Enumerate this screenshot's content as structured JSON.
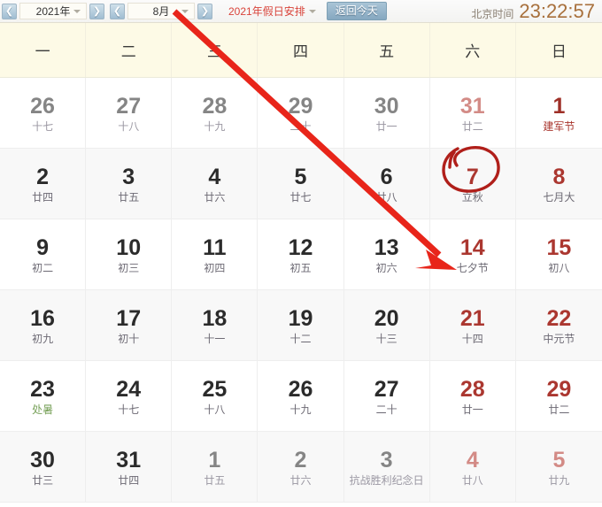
{
  "toolbar": {
    "prev_year_icon": "chevron-left-icon",
    "next_year_icon": "chevron-right-icon",
    "prev_month_icon": "chevron-left-icon",
    "next_month_icon": "chevron-right-icon",
    "year_value": "2021年",
    "month_value": "8月",
    "holiday_label": "2021年假日安排",
    "today_label": "返回今天",
    "clock_label": "北京时间",
    "clock_time": "23:22:57"
  },
  "weekdays": [
    "一",
    "二",
    "三",
    "四",
    "五",
    "六",
    "日"
  ],
  "colors": {
    "header_bg": "#fdfae6",
    "weekend_red": "#ab3730",
    "festival_red": "#a8342c",
    "solar_term_green": "#7aa35c",
    "other_month_gray": "#858585",
    "accent_blue": "#86a8c0",
    "clock_brown": "#a8703c",
    "annotation_red": "#e8251a"
  },
  "days": [
    {
      "num": "26",
      "sub": "十七",
      "type": "other"
    },
    {
      "num": "27",
      "sub": "十八",
      "type": "other"
    },
    {
      "num": "28",
      "sub": "十九",
      "type": "other"
    },
    {
      "num": "29",
      "sub": "二十",
      "type": "other"
    },
    {
      "num": "30",
      "sub": "廿一",
      "type": "other"
    },
    {
      "num": "31",
      "sub": "廿二",
      "type": "other-weekend"
    },
    {
      "num": "1",
      "sub": "建军节",
      "type": "festival",
      "sub_style": "fest"
    },
    {
      "num": "2",
      "sub": "廿四",
      "type": "normal"
    },
    {
      "num": "3",
      "sub": "廿五",
      "type": "normal"
    },
    {
      "num": "4",
      "sub": "廿六",
      "type": "normal"
    },
    {
      "num": "5",
      "sub": "廿七",
      "type": "normal"
    },
    {
      "num": "6",
      "sub": "廿八",
      "type": "normal"
    },
    {
      "num": "7",
      "sub": "立秋",
      "type": "weekend",
      "sub_style": "term",
      "circled": true
    },
    {
      "num": "8",
      "sub": "七月大",
      "type": "weekend"
    },
    {
      "num": "9",
      "sub": "初二",
      "type": "normal"
    },
    {
      "num": "10",
      "sub": "初三",
      "type": "normal"
    },
    {
      "num": "11",
      "sub": "初四",
      "type": "normal"
    },
    {
      "num": "12",
      "sub": "初五",
      "type": "normal"
    },
    {
      "num": "13",
      "sub": "初六",
      "type": "normal"
    },
    {
      "num": "14",
      "sub": "七夕节",
      "type": "weekend",
      "sub_style": "fest"
    },
    {
      "num": "15",
      "sub": "初八",
      "type": "weekend"
    },
    {
      "num": "16",
      "sub": "初九",
      "type": "normal"
    },
    {
      "num": "17",
      "sub": "初十",
      "type": "normal"
    },
    {
      "num": "18",
      "sub": "十一",
      "type": "normal"
    },
    {
      "num": "19",
      "sub": "十二",
      "type": "normal"
    },
    {
      "num": "20",
      "sub": "十三",
      "type": "normal"
    },
    {
      "num": "21",
      "sub": "十四",
      "type": "weekend"
    },
    {
      "num": "22",
      "sub": "中元节",
      "type": "weekend",
      "sub_style": "fest"
    },
    {
      "num": "23",
      "sub": "处暑",
      "type": "normal",
      "sub_style": "term"
    },
    {
      "num": "24",
      "sub": "十七",
      "type": "normal"
    },
    {
      "num": "25",
      "sub": "十八",
      "type": "normal"
    },
    {
      "num": "26",
      "sub": "十九",
      "type": "normal"
    },
    {
      "num": "27",
      "sub": "二十",
      "type": "normal"
    },
    {
      "num": "28",
      "sub": "廿一",
      "type": "weekend"
    },
    {
      "num": "29",
      "sub": "廿二",
      "type": "weekend"
    },
    {
      "num": "30",
      "sub": "廿三",
      "type": "normal"
    },
    {
      "num": "31",
      "sub": "廿四",
      "type": "normal"
    },
    {
      "num": "1",
      "sub": "廿五",
      "type": "other"
    },
    {
      "num": "2",
      "sub": "廿六",
      "type": "other"
    },
    {
      "num": "3",
      "sub": "抗战胜利纪念日",
      "type": "other",
      "sub_style": "fest-muted"
    },
    {
      "num": "4",
      "sub": "廿八",
      "type": "other-weekend"
    },
    {
      "num": "5",
      "sub": "廿九",
      "type": "other-weekend"
    }
  ],
  "annotations": {
    "arrow": {
      "name": "red-arrow-annotation",
      "from": "toolbar",
      "to": "day-14"
    },
    "circle": {
      "name": "red-circle-annotation",
      "target": "day-7"
    }
  }
}
